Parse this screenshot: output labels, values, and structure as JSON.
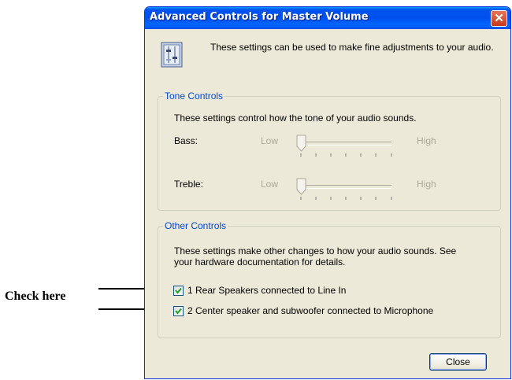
{
  "annotation": {
    "label": "Check here"
  },
  "window": {
    "title": "Advanced Controls for Master Volume",
    "close_glyph": "✕",
    "icon": "mixer-icon",
    "intro": "These settings can be used to make fine adjustments to your audio."
  },
  "tone_controls": {
    "legend": "Tone Controls",
    "description": "These settings control how the tone of your audio sounds.",
    "bass": {
      "label": "Bass:",
      "low": "Low",
      "high": "High",
      "level": 0
    },
    "treble": {
      "label": "Treble:",
      "low": "Low",
      "high": "High",
      "level": 0
    }
  },
  "other_controls": {
    "legend": "Other Controls",
    "description_line1": "These settings make other changes to how your audio sounds.  See",
    "description_line2": "your hardware documentation for details.",
    "options": [
      {
        "label": "1  Rear Speakers connected to Line In",
        "checked": true
      },
      {
        "label": "2  Center speaker and subwoofer connected to Microphone",
        "checked": true
      }
    ]
  },
  "buttons": {
    "close_label": "Close"
  },
  "colors": {
    "titlebar": "#0054e3",
    "group_label": "#0046d5",
    "disabled_text": "#aca899"
  }
}
